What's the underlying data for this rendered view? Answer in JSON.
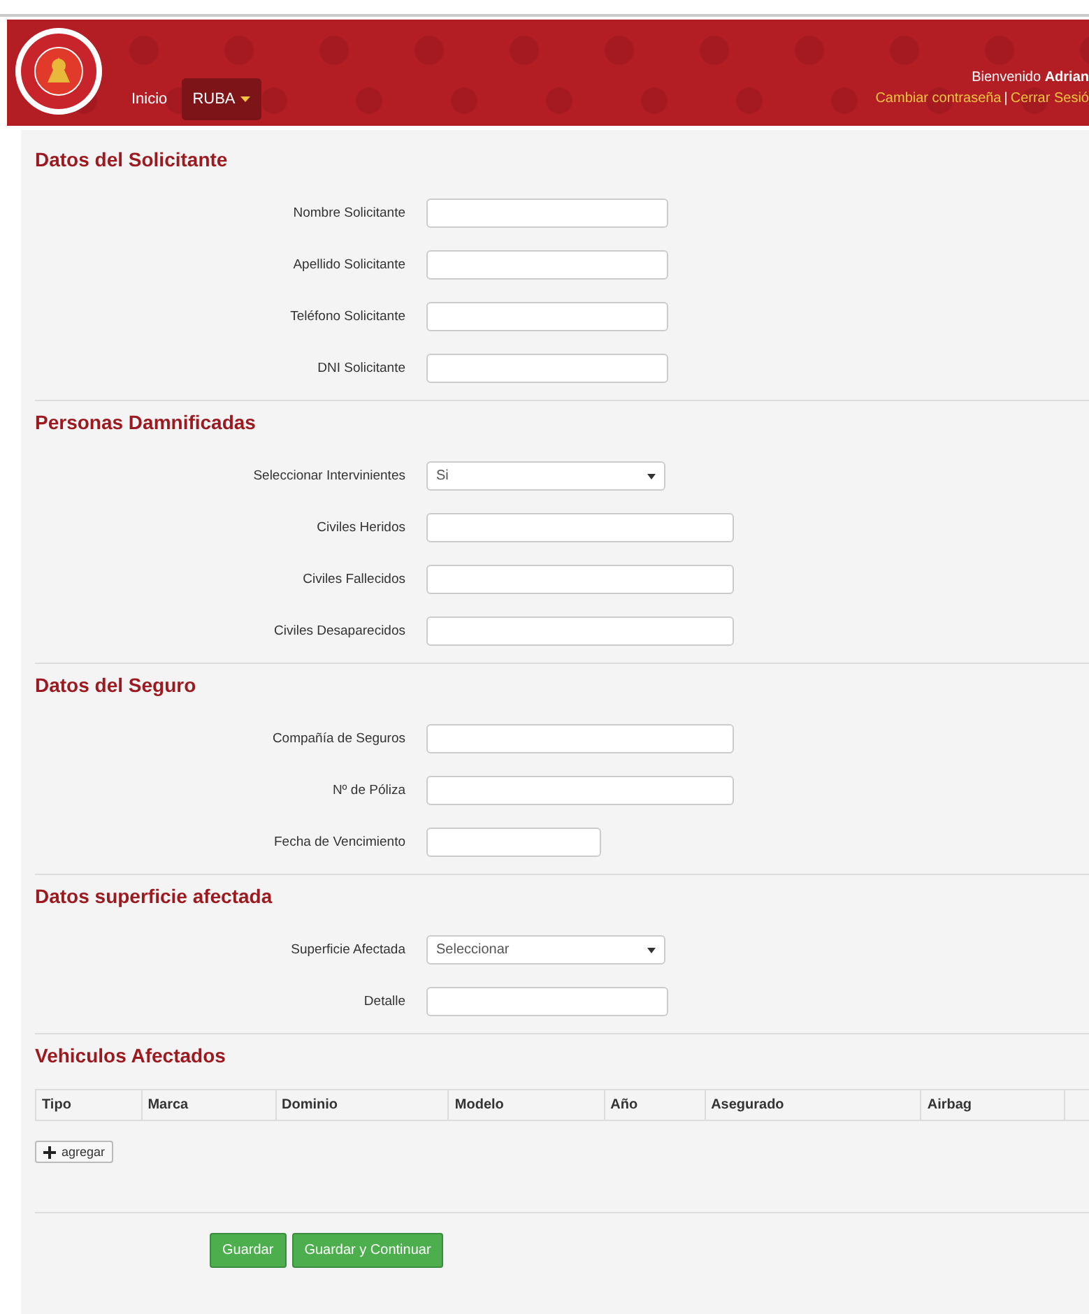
{
  "header": {
    "nav": [
      {
        "label": "Inicio",
        "kind": "link",
        "selected": false
      },
      {
        "label": "RUBA",
        "kind": "dropdown",
        "selected": true
      }
    ],
    "welcome": "Bienvenido **Adrian**",
    "links": [
      "Cambiar contraseña",
      "Cerrar Sesió"
    ],
    "separator": "|"
  },
  "sections": [
    {
      "title": "Datos del Solicitante",
      "fields": [
        {
          "label": "Nombre Solicitante",
          "kind": "text"
        },
        {
          "label": "Apellido Solicitante",
          "kind": "text"
        },
        {
          "label": "Teléfono Solicitante",
          "kind": "text"
        },
        {
          "label": "DNI Solicitante",
          "kind": "text"
        }
      ]
    },
    {
      "title": "Personas Damnificadas",
      "fields": [
        {
          "label": "Seleccionar Intervinientes",
          "kind": "select",
          "value": "Si"
        },
        {
          "label": "Civiles Heridos",
          "kind": "wide"
        },
        {
          "label": "Civiles Fallecidos",
          "kind": "wide"
        },
        {
          "label": "Civiles Desaparecidos",
          "kind": "wide"
        }
      ]
    },
    {
      "title": "Datos del Seguro",
      "fields": [
        {
          "label": "Compañía de Seguros",
          "kind": "wide"
        },
        {
          "label": "Nº de Póliza",
          "kind": "wide"
        },
        {
          "label": "Fecha de Vencimiento",
          "kind": "date"
        }
      ]
    },
    {
      "title": "Datos superficie afectada",
      "fields": [
        {
          "label": "Superficie Afectada",
          "kind": "select",
          "value": "Seleccionar"
        },
        {
          "label": "Detalle",
          "kind": "text"
        }
      ]
    }
  ],
  "vehicles": {
    "title": "Vehiculos Afectados",
    "columns": [
      "Tipo",
      "Marca",
      "Dominio",
      "Modelo",
      "Año",
      "Asegurado",
      "Airbag"
    ],
    "add_button": "agregar"
  },
  "buttons": [
    "Guardar",
    "Guardar y Continuar"
  ]
}
